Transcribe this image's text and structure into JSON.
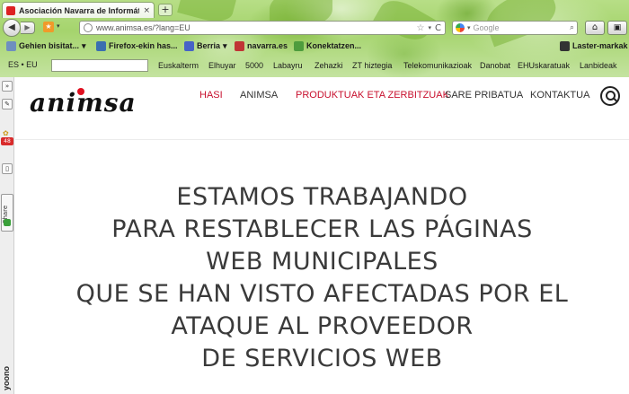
{
  "browser": {
    "tab_title": "Asociación Navarra de Informát...",
    "tab_close": "×",
    "new_tab": "+",
    "back": "◀",
    "forward": "▶",
    "url": "www.animsa.es/?lang=EU",
    "search_placeholder": "Google",
    "home": "⌂",
    "ext": "⌂",
    "star": "☆",
    "caret": "▾",
    "reload": "C",
    "search_mag": "🔍"
  },
  "bookmarks": [
    {
      "label": "Gehien bisitat...",
      "caret": "▾",
      "color": "#6f8fbf"
    },
    {
      "label": "Firefox-ekin has...",
      "color": "#3b6fb0"
    },
    {
      "label": "Berria",
      "caret": "▾",
      "color": "#4763c7"
    },
    {
      "label": "navarra.es",
      "color": "#c03535"
    },
    {
      "label": "Konektatzen...",
      "color": "#4e9c3d"
    },
    {
      "label": "Laster-markak",
      "color": "#333333"
    }
  ],
  "toolbar2": {
    "lang": "ES • EU",
    "links": [
      "Euskalterm",
      "Elhuyar",
      "5000",
      "Labayru",
      "Zehazki",
      "ZT hiztegia",
      "Telekomunikazioak",
      "Danobat",
      "EHUskaratuak",
      "Lanbideak"
    ]
  },
  "sidebar": {
    "expand": "»",
    "tool": "✎",
    "badge": "48",
    "flower": "✿",
    "panel": "▯",
    "share": "Share",
    "yoono": "yoono"
  },
  "site": {
    "logo": "animsa",
    "nav": [
      {
        "label": "HASI",
        "color": "red"
      },
      {
        "label": "ANIMSA",
        "color": "dark"
      },
      {
        "label": "PRODUKTUAK ETA ZERBITZUAK",
        "color": "red"
      },
      {
        "label": "SARE PRIBATUA",
        "color": "dark"
      },
      {
        "label": "KONTAKTUA",
        "color": "dark"
      }
    ],
    "message": [
      "ESTAMOS TRABAJANDO",
      "PARA RESTABLECER LAS PÁGINAS",
      "WEB MUNICIPALES",
      "QUE SE HAN VISTO AFECTADAS POR EL",
      "ATAQUE AL PROVEEDOR",
      "DE SERVICIOS WEB"
    ]
  }
}
